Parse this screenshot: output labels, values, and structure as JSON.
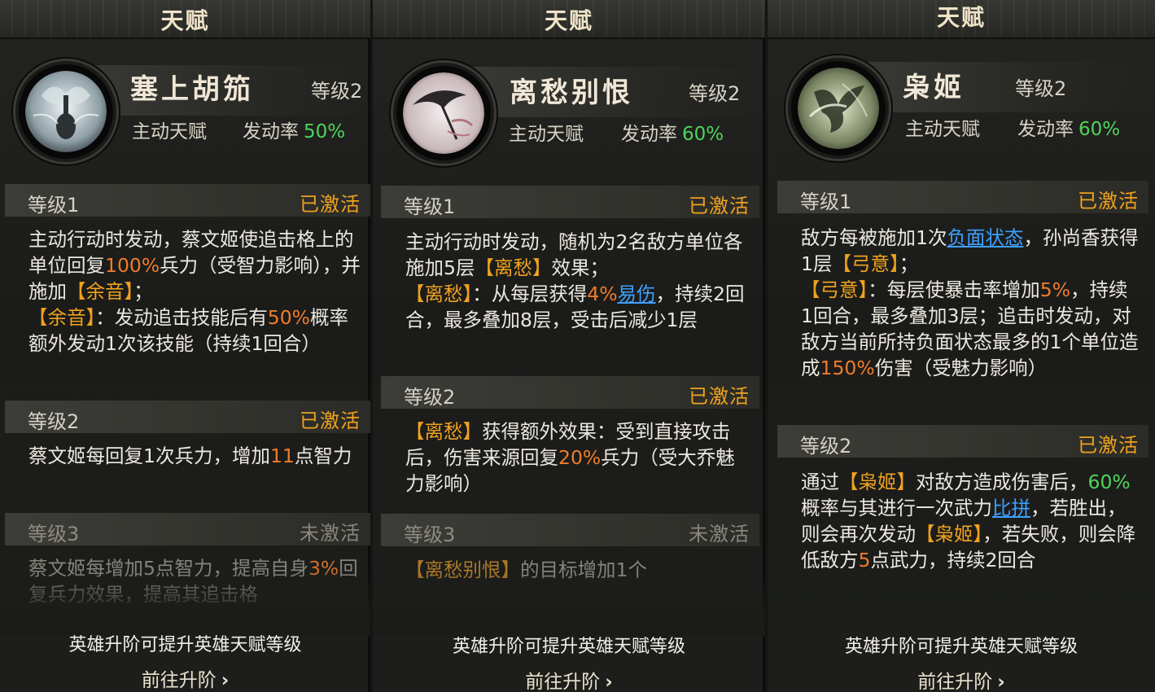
{
  "panels": [
    {
      "header": "天赋",
      "talent": {
        "name": "塞上胡笳",
        "level": "等级2",
        "type": "主动天赋",
        "rate_label": "发动率",
        "rate": "50%"
      },
      "levels": [
        {
          "name": "等级1",
          "status": "已激活"
        },
        {
          "name": "等级2",
          "status": "已激活"
        },
        {
          "name": "等级3",
          "status": "未激活"
        }
      ],
      "desc": [
        [
          "主动行动时发动，蔡文姬使追击格上的单位回复",
          "100%",
          "兵力（受智力影响），并施加",
          "【余音】",
          "；",
          "【余音】",
          "：发动追击技能后有",
          "50%",
          "概率额外发动1次该技能（持续1回合）"
        ],
        [
          "蔡文姬每回复1次兵力，增加",
          "11",
          "点智力"
        ],
        [
          "蔡文姬每增加5点智力，提高自身",
          "3%",
          "回复兵力效果，提高其追击格"
        ]
      ],
      "footer": {
        "note": "英雄升阶可提升英雄天赋等级",
        "link": "前往升阶"
      }
    },
    {
      "header": "天赋",
      "talent": {
        "name": "离愁别恨",
        "level": "等级2",
        "type": "主动天赋",
        "rate_label": "发动率",
        "rate": "60%"
      },
      "levels": [
        {
          "name": "等级1",
          "status": "已激活"
        },
        {
          "name": "等级2",
          "status": "已激活"
        },
        {
          "name": "等级3",
          "status": "未激活"
        }
      ],
      "desc": [
        [
          "主动行动时发动，随机为2名敌方单位各施加5层",
          "【离愁】",
          "效果；",
          "【离愁】",
          "：从每层获得",
          "4%",
          "易伤",
          "，持续2回合，最多叠加8层，受击后减少1层"
        ],
        [
          "【离愁】",
          "获得额外效果：受到直接攻击后，伤害来源回复",
          "20%",
          "兵力（受大乔魅力影响）"
        ],
        [
          "【离愁别恨】",
          "的目标增加1个"
        ]
      ],
      "footer": {
        "note": "英雄升阶可提升英雄天赋等级",
        "link": "前往升阶"
      }
    },
    {
      "header": "天赋",
      "talent": {
        "name": "枭姬",
        "level": "等级2",
        "type": "主动天赋",
        "rate_label": "发动率",
        "rate": "60%"
      },
      "levels": [
        {
          "name": "等级1",
          "status": "已激活"
        },
        {
          "name": "等级2",
          "status": "已激活"
        }
      ],
      "desc": [
        [
          "敌方每被施加1次",
          "负面状态",
          "，孙尚香获得1层",
          "【弓意】",
          "；",
          "【弓意】",
          "：每层使暴击率增加",
          "5%",
          "，持续1回合，最多叠加3层；追击时发动，对敌方当前所持负面状态最多的1个单位造成",
          "150%",
          "伤害（受魅力影响）"
        ],
        [
          "通过",
          "【枭姬】",
          "对敌方造成伤害后，",
          "60%",
          "概率与其进行一次武力",
          "比拼",
          "，若胜出，则会再次发动",
          "【枭姬】",
          "，若失败，则会降低敌方",
          "5",
          "点武力，持续2回合"
        ]
      ],
      "footer": {
        "note": "英雄升阶可提升英雄天赋等级",
        "link": "前往升阶"
      }
    }
  ],
  "colors": {
    "activated": "#f0a21e",
    "inactive": "#8a867e",
    "rate": "#4fd45a",
    "number": "#f07c2c",
    "keyword": "#f0a21e",
    "link": "#3ea0ff"
  },
  "icons": [
    "pipa-icon",
    "umbrella-icon",
    "phoenix-icon",
    "chevron-right-icon"
  ]
}
